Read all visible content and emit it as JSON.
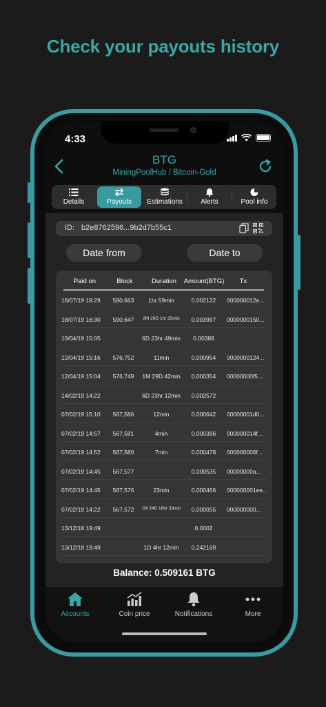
{
  "headline": "Check your payouts history",
  "status": {
    "time": "4:33"
  },
  "header": {
    "title": "BTG",
    "subtitle": "MiningPoolHub / Bitcoin-Gold"
  },
  "tabs": [
    {
      "label": "Details",
      "icon": "list-icon"
    },
    {
      "label": "Payouts",
      "icon": "swap-icon",
      "active": true
    },
    {
      "label": "Estimations",
      "icon": "coins-icon"
    },
    {
      "label": "Alerts",
      "icon": "bell-icon"
    },
    {
      "label": "Pool info",
      "icon": "pie-icon"
    }
  ],
  "id_bar": {
    "label": "ID:",
    "value": "b2e8762596...9b2d7b55c1"
  },
  "date_from_label": "Date from",
  "date_to_label": "Date to",
  "table": {
    "headers": [
      "Paid on",
      "Block",
      "Duration",
      "Amount(BTG)",
      "Tx"
    ],
    "rows": [
      [
        "18/07/19 18:29",
        "590,663",
        "1hr 59min",
        "0.002122",
        "000000012e..."
      ],
      [
        "18/07/19 16:30",
        "590,647",
        "2M 29D 1hr 25min",
        "0.003997",
        "0000000150..."
      ],
      [
        "19/04/19 15:05",
        "",
        "6D 23hr 49min",
        "0.00388",
        ""
      ],
      [
        "12/04/19 15:16",
        "576,752",
        "11min",
        "0.000954",
        "0000000124..."
      ],
      [
        "12/04/19 15:04",
        "576,749",
        "1M 29D 42min",
        "0.000354",
        "00000000f5..."
      ],
      [
        "14/02/19 14:22",
        "",
        "6D 23hr 12min",
        "0.002572",
        ""
      ],
      [
        "07/02/19 15:10",
        "567,586",
        "12min",
        "0.000642",
        "00000001d0..."
      ],
      [
        "07/02/19 14:57",
        "567,581",
        "4min",
        "0.000396",
        "000000014f..."
      ],
      [
        "07/02/19 14:52",
        "567,580",
        "7min",
        "0.000478",
        "000000006f..."
      ],
      [
        "07/02/19 14:45",
        "567,577",
        "",
        "0.000535",
        "00000000a..."
      ],
      [
        "07/02/19 14:45",
        "567,576",
        "23min",
        "0.000466",
        "000000001ee..."
      ],
      [
        "07/02/19 14:22",
        "567,572",
        "1M 24D 18hr 33min",
        "0.000055",
        "000000000..."
      ],
      [
        "13/12/18 19:49",
        "",
        "",
        "0.0002",
        ""
      ],
      [
        "13/12/18 19:49",
        "",
        "1D 4hr 12min",
        "0.242169",
        ""
      ]
    ]
  },
  "balance": "Balance: 0.509161 BTG",
  "bottom_nav": [
    {
      "label": "Accounts",
      "icon": "home-icon",
      "active": true
    },
    {
      "label": "Coin price",
      "icon": "chart-icon"
    },
    {
      "label": "Notifications",
      "icon": "bell-icon"
    },
    {
      "label": "More",
      "icon": "more-icon"
    }
  ],
  "colors": {
    "accent": "#3aa6a6",
    "background": "#232323",
    "frame": "#3a9aa1"
  }
}
